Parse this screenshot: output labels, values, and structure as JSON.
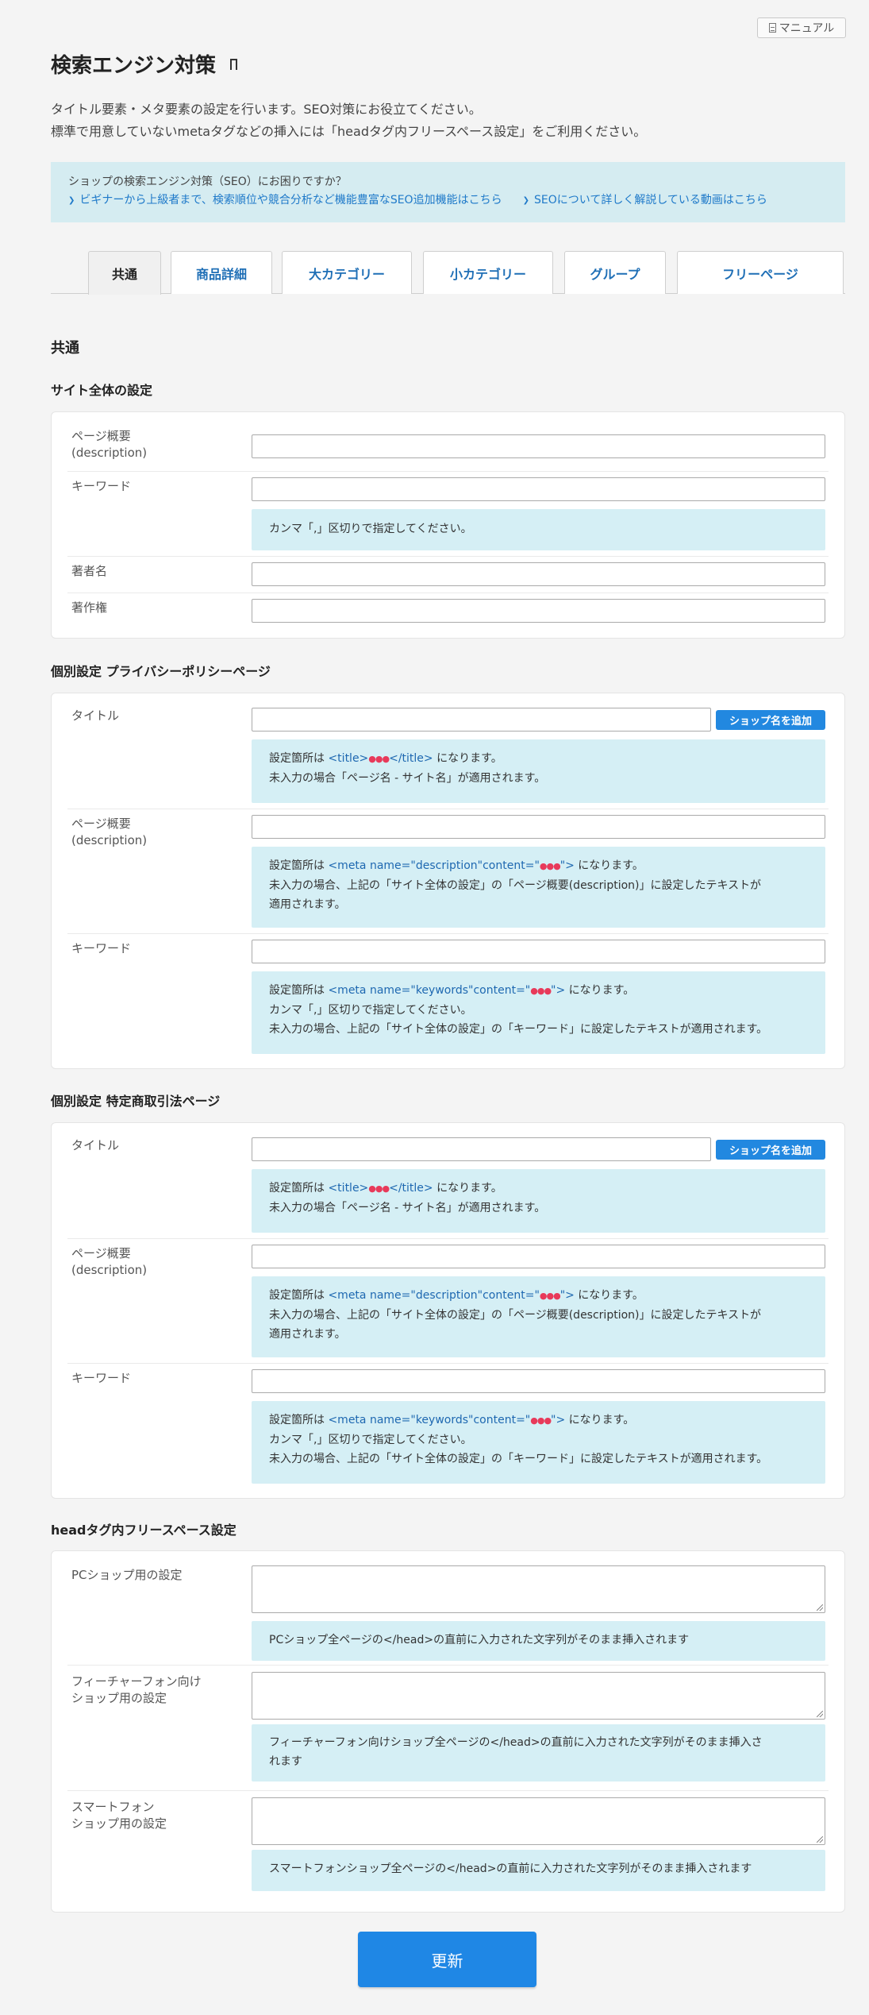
{
  "manual_label": "マニュアル",
  "title": "検索エンジン対策",
  "intro": [
    "タイトル要素・メタ要素の設定を行います。SEO対策にお役立てください。",
    "標準で用意していないmetaタグなどの挿入には「headタグ内フリースペース設定」をご利用ください。"
  ],
  "help": {
    "question": "ショップの検索エンジン対策（SEO）にお困りですか？",
    "link1": "ビギナーから上級者まで、検索順位や競合分析など機能豊富なSEO追加機能はこちら",
    "link2": "SEOについて詳しく解説している動画はこちら"
  },
  "tabs": [
    "共通",
    "商品詳細",
    "大カテゴリー",
    "小カテゴリー",
    "グループ",
    "フリーページ"
  ],
  "section_title": "共通",
  "site": {
    "heading": "サイト全体の設定",
    "desc_label": [
      "ページ概要",
      "(description)"
    ],
    "keyword_label": "キーワード",
    "keyword_note": "カンマ「,」区切りで指定してください。",
    "author_label": "著者名",
    "copyright_label": "著作権"
  },
  "privacy": {
    "heading": "個別設定 プライバシーポリシーページ"
  },
  "tokusho": {
    "heading": "個別設定 特定商取引法ページ"
  },
  "common": {
    "title_label": "タイトル",
    "shop_btn": "ショップ名を追加",
    "desc_label": [
      "ページ概要",
      "(description)"
    ],
    "keyword_label": "キーワード",
    "note_title": {
      "pre": "設定箇所は ",
      "code_open": "<title>",
      "dots": "●●●",
      "code_close": "</title>",
      "post": " になります。",
      "line2": "未入力の場合「ページ名 - サイト名」が適用されます。"
    },
    "note_desc": {
      "pre": "設定箇所は ",
      "code_open": "<meta name=\"description\"content=\"",
      "dots": "●●●",
      "code_close": "\">",
      "post": " になります。",
      "line2": "未入力の場合、上記の「サイト全体の設定」の「ページ概要(description)」に設定したテキストが",
      "line3": "適用されます。"
    },
    "note_kw": {
      "pre": "設定箇所は ",
      "code_open": "<meta name=\"keywords\"content=\"",
      "dots": "●●●",
      "code_close": "\">",
      "post": " になります。",
      "line2": "カンマ「,」区切りで指定してください。",
      "line3": "未入力の場合、上記の「サイト全体の設定」の「キーワード」に設定したテキストが適用されます。"
    }
  },
  "head": {
    "heading": "headタグ内フリースペース設定",
    "pc_label": "PCショップ用の設定",
    "pc_note": "PCショップ全ページの</head>の直前に入力された文字列がそのまま挿入されます",
    "fp_label": [
      "フィーチャーフォン向け",
      "ショップ用の設定"
    ],
    "fp_note": [
      "フィーチャーフォン向けショップ全ページの</head>の直前に入力された文字列がそのまま挿入さ",
      "れます"
    ],
    "sp_label": [
      "スマートフォン",
      "ショップ用の設定"
    ],
    "sp_note": "スマートフォンショップ全ページの</head>の直前に入力された文字列がそのまま挿入されます"
  },
  "update_btn": "更新"
}
